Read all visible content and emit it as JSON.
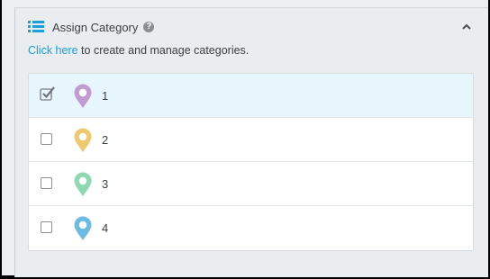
{
  "section": {
    "title": "Assign Category",
    "help": "?",
    "link_text": "Click here",
    "description_rest": " to create and manage categories."
  },
  "categories": [
    {
      "label": "1",
      "checked": true,
      "color": "#c39bd3"
    },
    {
      "label": "2",
      "checked": false,
      "color": "#f0c96e"
    },
    {
      "label": "3",
      "checked": false,
      "color": "#8ed9b0"
    },
    {
      "label": "4",
      "checked": false,
      "color": "#6bbbe3"
    }
  ],
  "colors": {
    "accent": "#1a9fd8",
    "selected_row": "#e7f5fc"
  }
}
